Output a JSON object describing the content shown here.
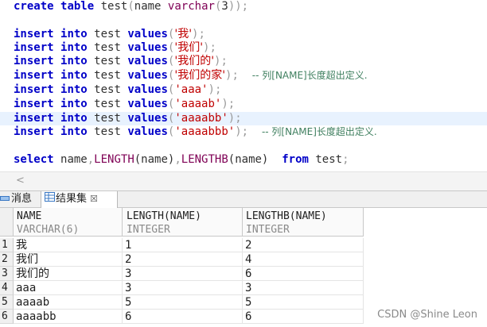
{
  "editor": {
    "lines": [
      {
        "kind": "create",
        "kw1": "create",
        "kw2": "table",
        "table": "test",
        "paren_open": "(",
        "col": "name",
        "type": "varchar",
        "arg_open": "(",
        "arg": "3",
        "arg_close": "))",
        "semi": ";"
      },
      {
        "kind": "insert",
        "kw1": "insert",
        "kw2": "into",
        "table": "test",
        "kw3": "values",
        "open": "(",
        "value": "'我'",
        "close": ")",
        "semi": ";",
        "comment": ""
      },
      {
        "kind": "insert",
        "kw1": "insert",
        "kw2": "into",
        "table": "test",
        "kw3": "values",
        "open": "(",
        "value": "'我们'",
        "close": ")",
        "semi": ";",
        "comment": ""
      },
      {
        "kind": "insert",
        "kw1": "insert",
        "kw2": "into",
        "table": "test",
        "kw3": "values",
        "open": "(",
        "value": "'我们的'",
        "close": ")",
        "semi": ";",
        "comment": ""
      },
      {
        "kind": "insert",
        "kw1": "insert",
        "kw2": "into",
        "table": "test",
        "kw3": "values",
        "open": "(",
        "value": "'我们的家'",
        "close": ")",
        "semi": ";",
        "comment": "-- 列[NAME]长度超出定义."
      },
      {
        "kind": "insert",
        "kw1": "insert",
        "kw2": "into",
        "table": "test",
        "kw3": "values",
        "open": "(",
        "value": "'aaa'",
        "close": ")",
        "semi": ";",
        "comment": ""
      },
      {
        "kind": "insert",
        "kw1": "insert",
        "kw2": "into",
        "table": "test",
        "kw3": "values",
        "open": "(",
        "value": "'aaaab'",
        "close": ")",
        "semi": ";",
        "comment": ""
      },
      {
        "kind": "insert",
        "kw1": "insert",
        "kw2": "into",
        "table": "test",
        "kw3": "values",
        "open": "(",
        "value": "'aaaabb'",
        "close": ")",
        "semi": ";",
        "comment": ""
      },
      {
        "kind": "insert",
        "kw1": "insert",
        "kw2": "into",
        "table": "test",
        "kw3": "values",
        "open": "(",
        "value": "'aaaabbb'",
        "close": ")",
        "semi": ";",
        "comment": "-- 列[NAME]长度超出定义."
      },
      {
        "kind": "select",
        "kw1": "select",
        "col": "name",
        "comma1": ",",
        "fn1": "LENGTH",
        "arg1": "(name)",
        "comma2": ",",
        "fn2": "LENGTHB",
        "arg2": "(name)",
        "kw2": "from",
        "table": "test",
        "semi": ";"
      }
    ]
  },
  "scroll": {
    "left_arrow": "<"
  },
  "panel": {
    "tabs": [
      {
        "label": "消息",
        "icon": "messages-icon"
      },
      {
        "label": "结果集",
        "icon": "grid-icon",
        "close": "☒"
      }
    ]
  },
  "grid": {
    "columns": [
      {
        "name": "NAME",
        "type": "VARCHAR(6)"
      },
      {
        "name": "LENGTH(NAME)",
        "type": "INTEGER"
      },
      {
        "name": "LENGTHB(NAME)",
        "type": "INTEGER"
      }
    ],
    "rows": [
      {
        "num": "1",
        "cells": [
          "我",
          "1",
          "2"
        ]
      },
      {
        "num": "2",
        "cells": [
          "我们",
          "2",
          "4"
        ]
      },
      {
        "num": "3",
        "cells": [
          "我们的",
          "3",
          "6"
        ]
      },
      {
        "num": "4",
        "cells": [
          "aaa",
          "3",
          "3"
        ]
      },
      {
        "num": "5",
        "cells": [
          "aaaab",
          "5",
          "5"
        ]
      },
      {
        "num": "6",
        "cells": [
          "aaaabb",
          "6",
          "6"
        ]
      }
    ]
  },
  "watermark": "CSDN @Shine Leon",
  "colors": {
    "keyword": "#0000c8",
    "string": "#c00000",
    "function": "#7f0055",
    "comment": "#3f7f5f",
    "highlight": "#e8f2fe"
  }
}
